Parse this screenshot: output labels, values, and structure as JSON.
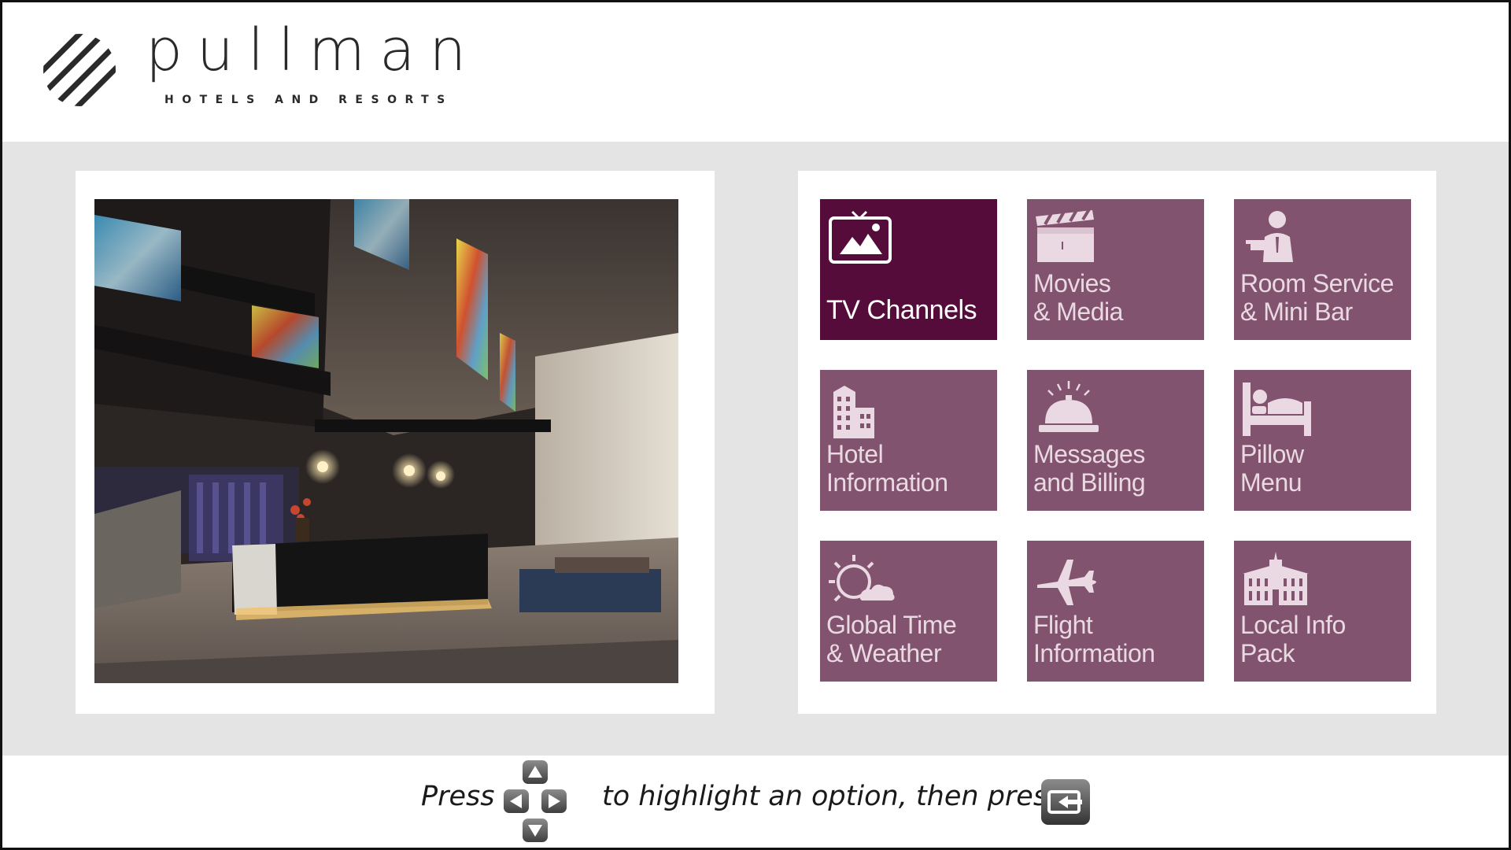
{
  "brand": {
    "name": "pullman",
    "tagline": "HOTELS AND RESORTS"
  },
  "menu": {
    "tiles": [
      {
        "label": "TV Channels",
        "icon": "tv-icon",
        "selected": true
      },
      {
        "label": "Movies\n& Media",
        "icon": "clapperboard-icon",
        "selected": false
      },
      {
        "label": "Room Service\n& Mini Bar",
        "icon": "waiter-icon",
        "selected": false
      },
      {
        "label": "Hotel\nInformation",
        "icon": "hotel-building-icon",
        "selected": false
      },
      {
        "label": "Messages\nand Billing",
        "icon": "service-bell-icon",
        "selected": false
      },
      {
        "label": "Pillow\nMenu",
        "icon": "bed-icon",
        "selected": false
      },
      {
        "label": "Global Time\n& Weather",
        "icon": "sun-cloud-icon",
        "selected": false
      },
      {
        "label": "Flight\nInformation",
        "icon": "airplane-icon",
        "selected": false
      },
      {
        "label": "Local Info\nPack",
        "icon": "landmark-building-icon",
        "selected": false
      }
    ]
  },
  "footer": {
    "press_label": "Press",
    "instruction": "to highlight an option, then press",
    "dpad_icon": "dpad-arrows-icon",
    "enter_icon": "enter-key-icon"
  },
  "colors": {
    "tile": "#81536e",
    "tile_selected": "#560c3a",
    "band": "#e4e4e4"
  }
}
